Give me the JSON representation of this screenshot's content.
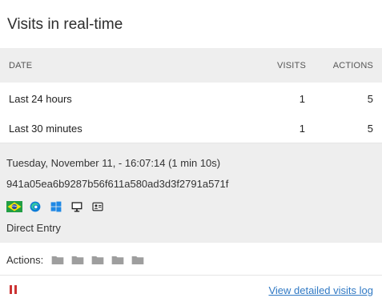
{
  "widget": {
    "title": "Visits in real-time"
  },
  "table": {
    "headers": {
      "date": "DATE",
      "visits": "VISITS",
      "actions": "ACTIONS"
    },
    "rows": [
      {
        "date": "Last 24 hours",
        "visits": "1",
        "actions": "5"
      },
      {
        "date": "Last 30 minutes",
        "visits": "1",
        "actions": "5"
      }
    ]
  },
  "visit": {
    "datetime": "Tuesday, November 11, - 16:07:14 (1 min 10s)",
    "visitor_id": "941a05ea6b9287b56f611a580ad3d3f2791a571f",
    "icons": [
      "brazil-flag-icon",
      "edge-browser-icon",
      "windows-icon",
      "desktop-icon",
      "visitor-profile-icon"
    ],
    "referrer": "Direct Entry"
  },
  "actions": {
    "label": "Actions:",
    "count": 5
  },
  "footer": {
    "link_label": "View detailed visits log"
  },
  "colors": {
    "header_bg": "#eeeeee",
    "link": "#3079c4",
    "pause": "#cc3333"
  }
}
